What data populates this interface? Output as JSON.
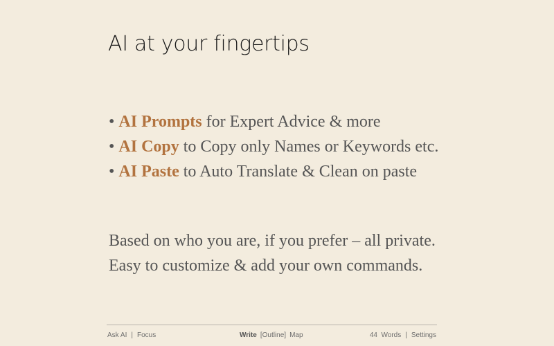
{
  "title": "AI at your fingertips",
  "features": [
    {
      "bullet": "•",
      "highlight": "AI Prompts",
      "text": " for Expert Advice & more"
    },
    {
      "bullet": "•",
      "highlight": "AI Copy",
      "text": " to Copy only Names or Keywords etc."
    },
    {
      "bullet": "•",
      "highlight": "AI Paste",
      "text": " to Auto Translate & Clean on paste"
    }
  ],
  "body": [
    "Based on who you are, if you prefer – all private.",
    "Easy to customize & add your own commands."
  ],
  "footer": {
    "ask_ai": "Ask AI",
    "separator": "|",
    "focus": "Focus",
    "write": "Write",
    "outline": "[Outline]",
    "map": "Map",
    "word_count": "44",
    "words_label": "Words",
    "settings": "Settings"
  },
  "colors": {
    "background": "#f3ecde",
    "accent": "#b2733f",
    "text": "#555555",
    "title": "#1a1a1a"
  }
}
